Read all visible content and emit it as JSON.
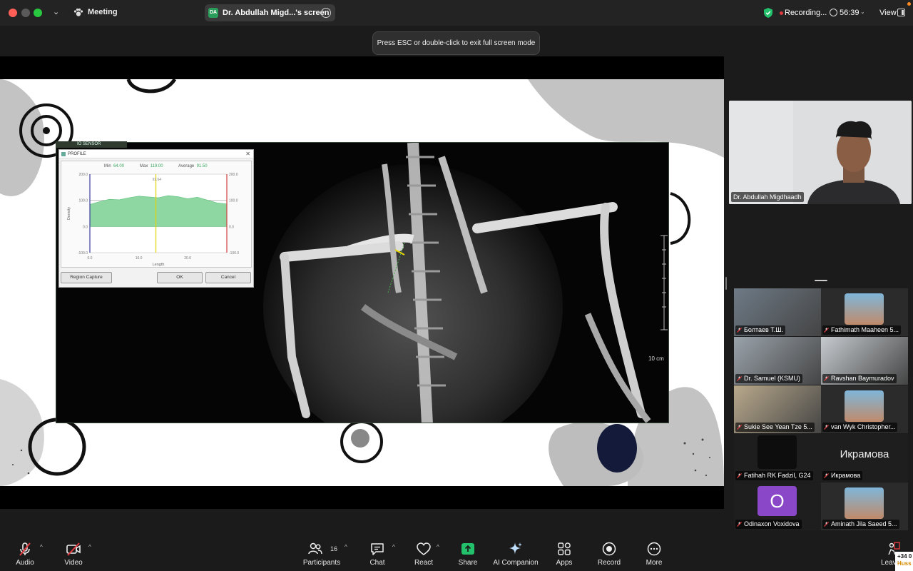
{
  "titlebar": {
    "title": "Meeting",
    "share_badge": "DA",
    "share_label": "Dr. Abdullah Migd...'s screen",
    "recording": "Recording...",
    "timer": "56:39",
    "view": "View"
  },
  "tooltip": "Press ESC or double-click to exit full screen mode",
  "shared_screen": {
    "panel_tab": "IO SENSOR",
    "profile": {
      "title": "PROFILE",
      "min_label": "Min",
      "min_value": "64.00",
      "max_label": "Max",
      "max_value": "119.00",
      "avg_label": "Average",
      "avg_value": "91.50",
      "cursor_value": "92.64",
      "y_axis_label": "Density",
      "x_axis_label": "Length",
      "y_ticks": [
        "200.0",
        "100.0",
        "0.0",
        "-100.0"
      ],
      "y_ticks_right": [
        "200.0",
        "100.0",
        "0.0",
        "-100.0"
      ],
      "x_ticks": [
        "0.0",
        "10.0",
        "20.0"
      ],
      "buttons": {
        "region": "Region Capture",
        "ok": "OK",
        "cancel": "Cancel"
      },
      "chart_data": {
        "type": "area",
        "x": [
          0,
          2,
          4,
          6,
          8,
          10,
          12,
          14,
          16,
          18,
          20,
          22,
          24,
          26,
          28
        ],
        "values": [
          84,
          95,
          104,
          102,
          110,
          116,
          113,
          110,
          118,
          114,
          106,
          112,
          101,
          90,
          86
        ],
        "ylim": [
          -100,
          200
        ],
        "xlim": [
          0,
          28
        ],
        "color": "#8fd7a2"
      }
    },
    "scale_label": "10 cm"
  },
  "speaker": {
    "name": "Dr. Abdullah Migdhaadh"
  },
  "gallery": [
    {
      "name": "Болтаев Т.Ш.",
      "bg": "#6e7a86"
    },
    {
      "name": "Fathimath Maaheen 5...",
      "bg": "#2b2b2b"
    },
    {
      "name": "Dr. Samuel (KSMU)",
      "bg": "#9aa3ab"
    },
    {
      "name": "Ravshan Baymuradov",
      "bg": "#c6cbcf"
    },
    {
      "name": "Sukie See Yean Tze 5...",
      "bg": "#b9a98c"
    },
    {
      "name": "van Wyk Christopher...",
      "bg": "#2b2b2b"
    },
    {
      "name": "Fatihah RK Fadzil, G24",
      "bg": "#1e1e1e"
    },
    {
      "name": "Икрамова",
      "bg": "#1e1e1e",
      "text": "Икрамова"
    },
    {
      "name": "Odinaxon Voxidova",
      "bg": "#1e1e1e",
      "avatar": "O"
    },
    {
      "name": "Aminath Jila Saeed 5...",
      "bg": "#2b2b2b"
    }
  ],
  "peek": {
    "line1": "+34 0",
    "line2": "Huss"
  },
  "toolbar": {
    "audio": "Audio",
    "video": "Video",
    "participants": "Participants",
    "participants_count": "16",
    "chat": "Chat",
    "react": "React",
    "share": "Share",
    "ai": "AI Companion",
    "apps": "Apps",
    "record": "Record",
    "more": "More",
    "leave": "Leave"
  },
  "colors": {
    "share_green": "#23c16b",
    "recording_red": "#e0393e",
    "muted_red": "#e0393e"
  }
}
